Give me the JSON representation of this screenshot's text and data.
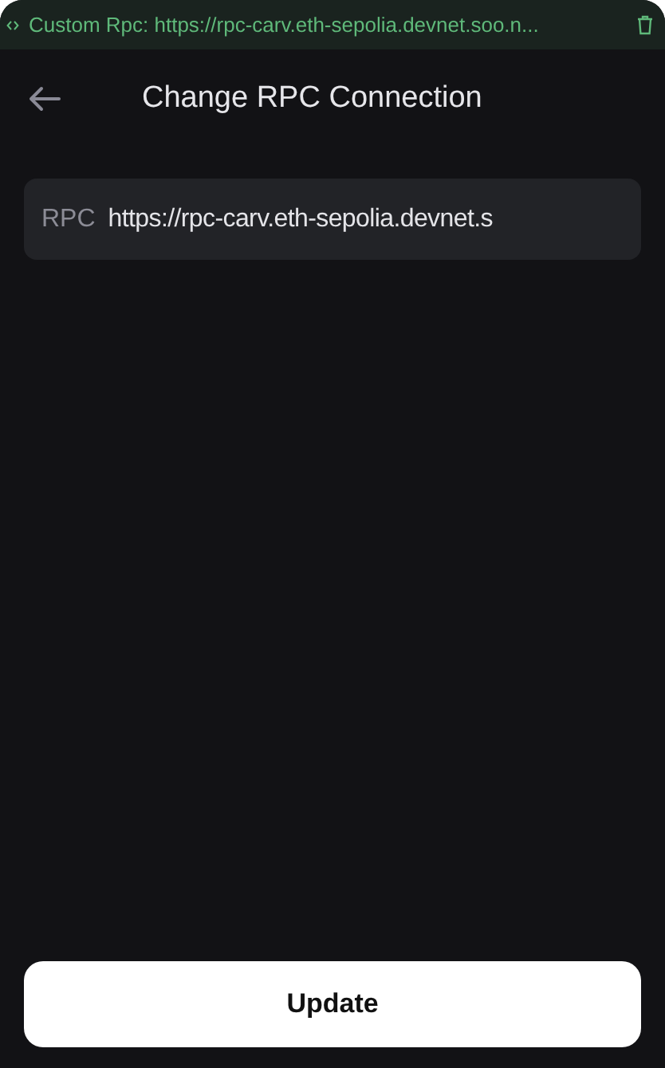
{
  "banner": {
    "text": "Custom Rpc: https://rpc-carv.eth-sepolia.devnet.soo.n..."
  },
  "header": {
    "title": "Change RPC Connection"
  },
  "field": {
    "label": "RPC",
    "value": "https://rpc-carv.eth-sepolia.devnet.s"
  },
  "buttons": [
    "Update"
  ]
}
